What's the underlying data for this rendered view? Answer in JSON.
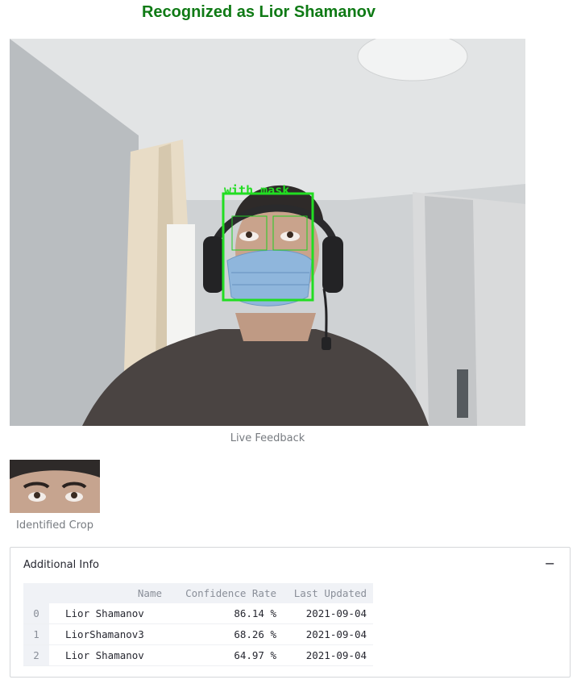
{
  "title": "Recognized as Lior Shamanov",
  "live_feed": {
    "caption": "Live Feedback",
    "detection_label": "with mask",
    "box_color": "#22dd22"
  },
  "crop": {
    "caption": "Identified Crop"
  },
  "info": {
    "header": "Additional Info",
    "toggle": "−",
    "columns": [
      "Name",
      "Confidence Rate",
      "Last Updated"
    ],
    "rows": [
      {
        "index": "0",
        "name": "Lior Shamanov",
        "confidence": "86.14 %",
        "updated": "2021-09-04"
      },
      {
        "index": "1",
        "name": "LiorShamanov3",
        "confidence": "68.26 %",
        "updated": "2021-09-04"
      },
      {
        "index": "2",
        "name": "Lior Shamanov",
        "confidence": "64.97 %",
        "updated": "2021-09-04"
      }
    ]
  },
  "colors": {
    "title": "#0f7a15",
    "caption": "#777b80",
    "table_header_bg": "#f0f2f6"
  }
}
